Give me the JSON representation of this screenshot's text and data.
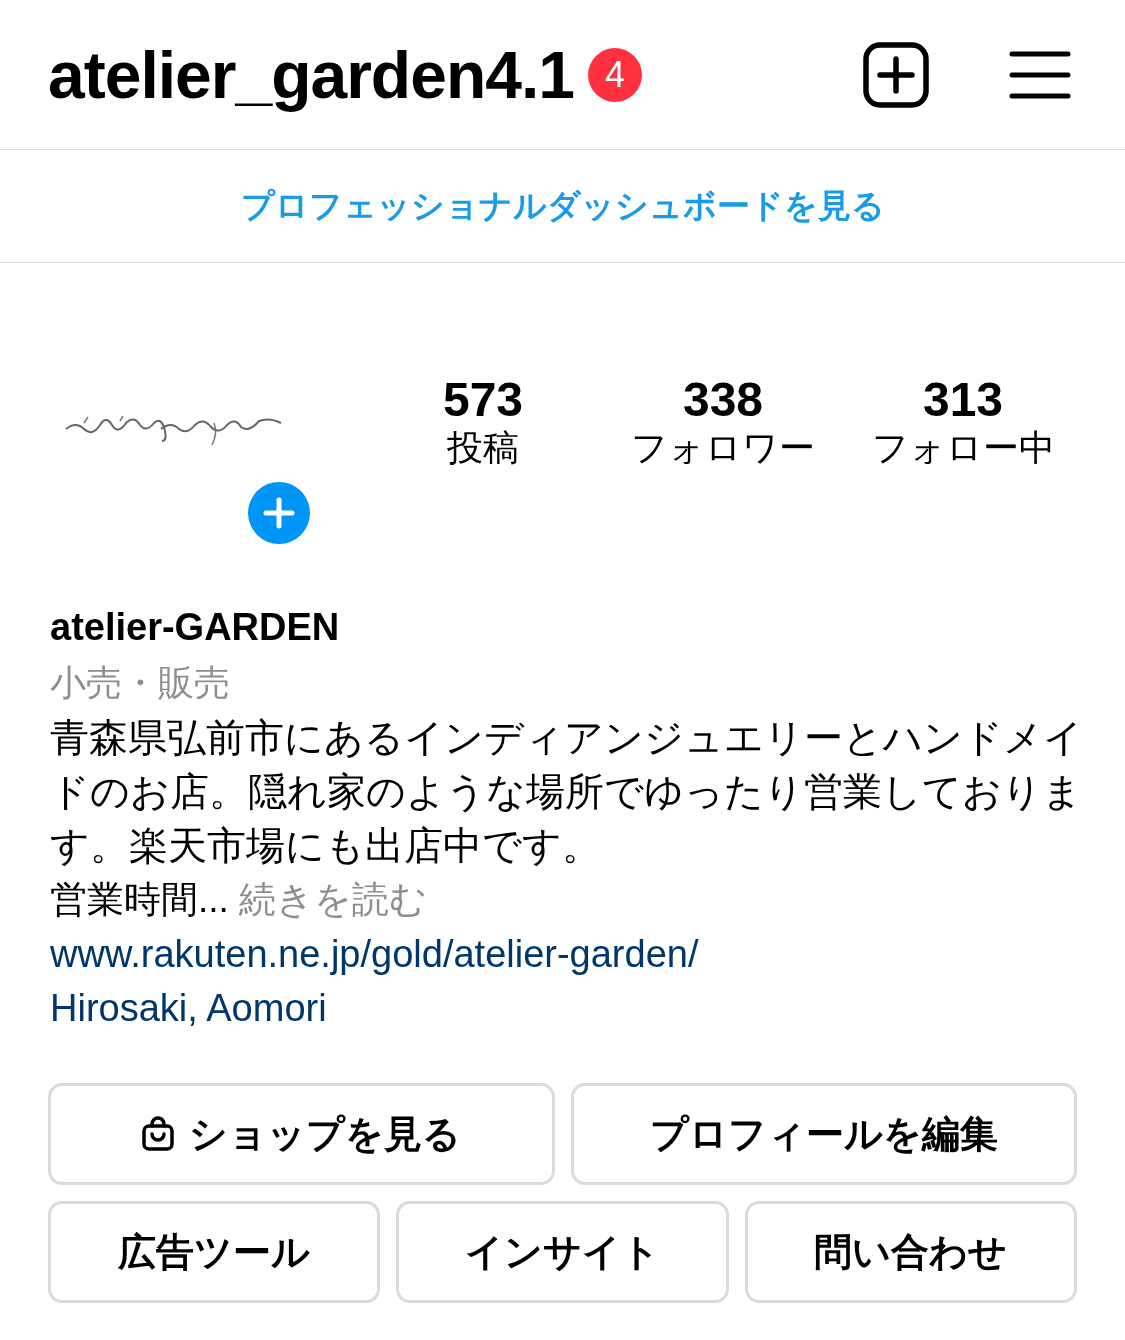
{
  "header": {
    "username": "atelier_garden4.1",
    "badge": "4"
  },
  "dashboard_link": "プロフェッショナルダッシュボードを見る",
  "profile": {
    "stats": [
      {
        "value": "573",
        "label": "投稿"
      },
      {
        "value": "338",
        "label": "フォロワー"
      },
      {
        "value": "313",
        "label": "フォロー中"
      }
    ]
  },
  "bio": {
    "name": "atelier-GARDEN",
    "category": "小売・販売",
    "text": "青森県弘前市にあるインディアンジュエリーとハンドメイドのお店。隠れ家のような場所でゆったり営業しております。楽天市場にも出店中です。",
    "hours": "営業時間...",
    "more": "続きを読む",
    "website": "www.rakuten.ne.jp/gold/atelier-garden/",
    "location": "Hirosaki, Aomori"
  },
  "buttons": [
    {
      "label": "ショップを見る",
      "kind": "shop"
    },
    {
      "label": "プロフィールを編集",
      "kind": "plain"
    },
    {
      "label": "広告ツール",
      "kind": "plain"
    },
    {
      "label": "インサイト",
      "kind": "plain"
    },
    {
      "label": "問い合わせ",
      "kind": "plain"
    }
  ]
}
